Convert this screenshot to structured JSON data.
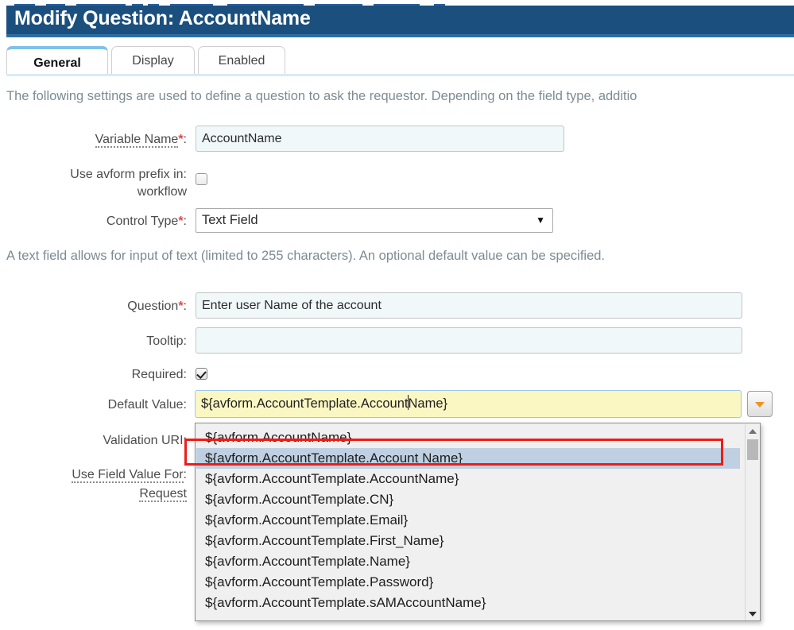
{
  "window": {
    "title": "Modify Question: AccountName"
  },
  "tabs": [
    {
      "label": "General",
      "active": true
    },
    {
      "label": "Display",
      "active": false
    },
    {
      "label": "Enabled",
      "active": false
    }
  ],
  "descriptions": {
    "general": "The following settings are used to define a question to ask the requestor. Depending on the field type, additio",
    "control_type": "A text field allows for input of text (limited to 255 characters). An optional default value can be specified."
  },
  "fields": {
    "variable_name": {
      "label": "Variable Name",
      "required_marker": "*",
      "colon": ":",
      "value": "AccountName"
    },
    "avform_prefix": {
      "label_line1": "Use avform prefix in",
      "label_line2": "workflow",
      "colon": ":",
      "checked": false
    },
    "control_type": {
      "label": "Control Type",
      "required_marker": "*",
      "colon": ":",
      "value": "Text Field",
      "caret": "▼"
    },
    "question": {
      "label": "Question",
      "required_marker": "*",
      "colon": ":",
      "value": "Enter user Name of the account"
    },
    "tooltip": {
      "label": "Tooltip",
      "colon": ":",
      "value": ""
    },
    "required": {
      "label": "Required",
      "colon": ":",
      "checked": true
    },
    "default_value": {
      "label": "Default Value",
      "colon": ":",
      "value_before_caret": "${avform.AccountTemplate.Account",
      "value_after_caret": "Name}",
      "full_value": "${avform.AccountTemplate.AccountName}"
    },
    "validation_uri": {
      "label": "Validation URI",
      "colon": ":",
      "value": ""
    },
    "use_field_value_for": {
      "label_line1": "Use Field Value For",
      "label_line2": "Request",
      "colon": ":"
    }
  },
  "autocomplete": {
    "options": [
      "${avform.AccountName}",
      "${avform.AccountTemplate.Account Name}",
      "${avform.AccountTemplate.AccountName}",
      "${avform.AccountTemplate.CN}",
      "${avform.AccountTemplate.Email}",
      "${avform.AccountTemplate.First_Name}",
      "${avform.AccountTemplate.Name}",
      "${avform.AccountTemplate.Password}",
      "${avform.AccountTemplate.sAMAccountName}"
    ],
    "selected_index": 1,
    "scroll_up_arrow": "▲",
    "scroll_down_arrow": "▼"
  },
  "annotation": {
    "highlight_color": "#ee1c18",
    "target": "${avform.AccountTemplate.Account Name}"
  },
  "colors": {
    "title_bar": "#1b4f7e",
    "title_accent": "#2d6da3",
    "active_tab_border": "#7ec2ea",
    "input_background": "#f1f8fa",
    "autocomplete_background": "#fbf7c3",
    "selected_option": "#bfd0e2",
    "required_asterisk": "#e8434b",
    "trigger_arrow": "#f0921e",
    "annotation_red": "#ee1c18"
  }
}
